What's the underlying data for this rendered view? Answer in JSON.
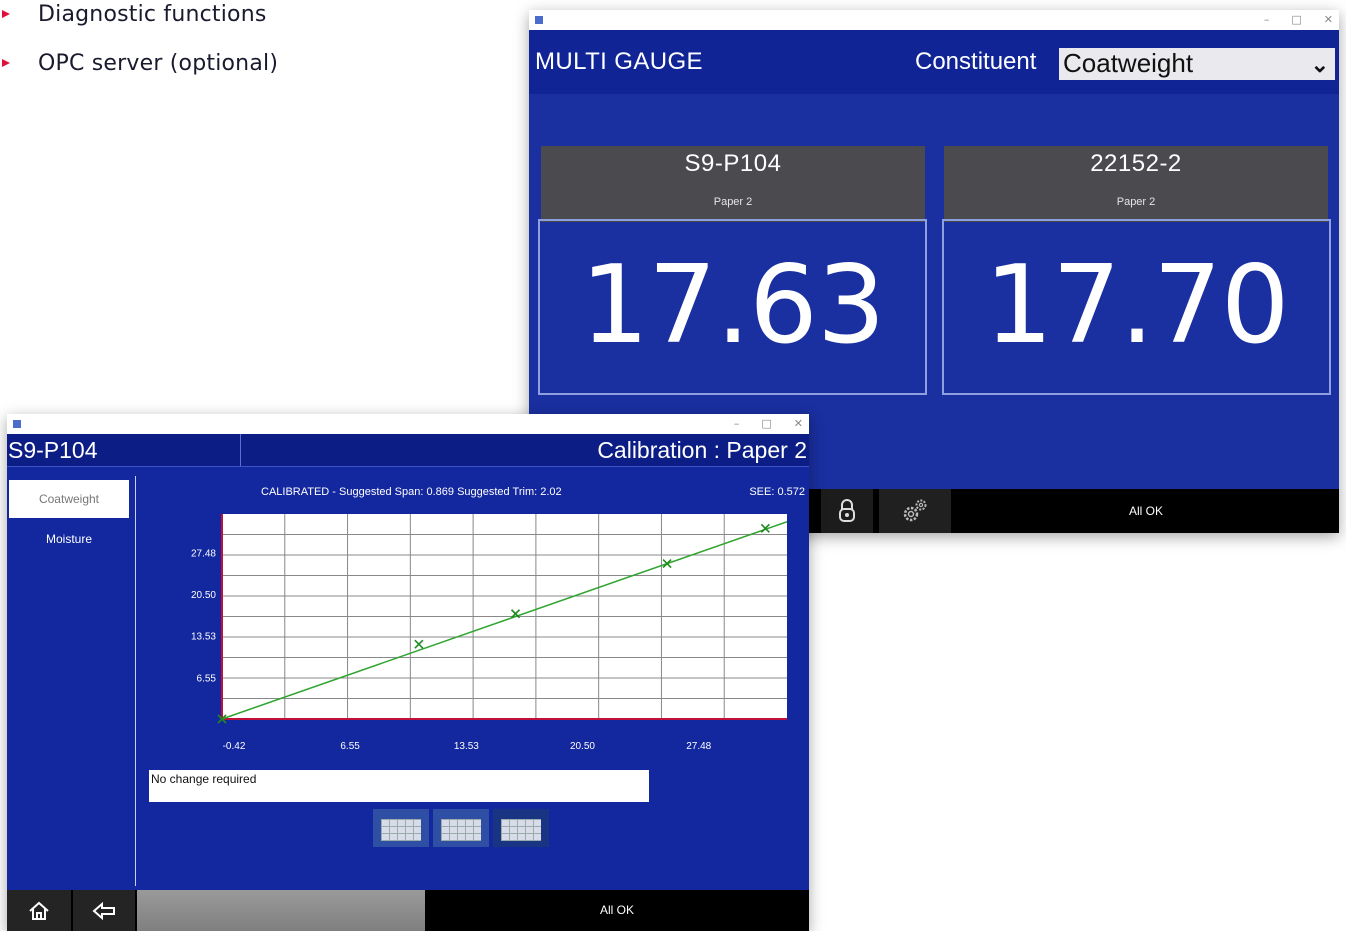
{
  "bullets": [
    "Diagnostic functions",
    "OPC server (optional)"
  ],
  "gauge_window": {
    "titlebar": "",
    "app_title": "MULTI GAUGE",
    "constituent_label": "Constituent",
    "constituent_value": "Coatweight",
    "gauges": [
      {
        "name": "S9-P104",
        "product": "Paper 2",
        "value": "17.63"
      },
      {
        "name": "22152-2",
        "product": "Paper 2",
        "value": "17.70"
      }
    ],
    "status": "All OK",
    "icons": {
      "lock": "lock-icon",
      "settings": "gears-icon"
    }
  },
  "calibration_window": {
    "titlebar": "",
    "device": "S9-P104",
    "title": "Calibration : Paper 2",
    "sidebar": [
      {
        "label": "Coatweight",
        "active": true
      },
      {
        "label": "Moisture",
        "active": false
      }
    ],
    "info": "CALIBRATED - Suggested Span: 0.869   Suggested Trim: 2.02",
    "see": "SEE: 0.572",
    "message": "No change required",
    "status": "All OK",
    "view_buttons": [
      "grid-view",
      "fit-view",
      "scatter-view"
    ]
  },
  "chart_data": {
    "type": "scatter",
    "title": "",
    "xlabel": "",
    "ylabel": "",
    "x_ticks": [
      "-0.42",
      "6.55",
      "13.53",
      "20.50",
      "27.48"
    ],
    "y_ticks": [
      "27.48",
      "20.50",
      "13.53",
      "6.55"
    ],
    "xlim": [
      -0.42,
      33.5
    ],
    "ylim": [
      -0.42,
      33.9
    ],
    "grid": true,
    "points": [
      [
        -0.42,
        -0.42
      ],
      [
        11.4,
        12.1
      ],
      [
        17.2,
        17.2
      ],
      [
        26.3,
        25.6
      ],
      [
        32.2,
        31.5
      ]
    ],
    "fit_line": [
      [
        -0.42,
        -0.42
      ],
      [
        33.5,
        32.6
      ]
    ],
    "colors": {
      "fit": "#2fa52f",
      "points": "#1f8a1f",
      "grid": "#888888",
      "axis": "#c0103a"
    }
  }
}
